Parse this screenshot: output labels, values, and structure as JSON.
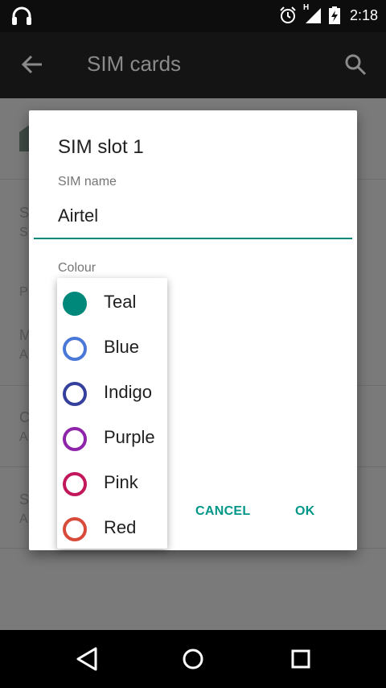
{
  "status": {
    "time": "2:18",
    "network_label": "H"
  },
  "appbar": {
    "title": "SIM cards"
  },
  "background_list": {
    "rows": [
      {
        "text": "S"
      },
      {
        "text": "S"
      },
      {
        "text": "P"
      },
      {
        "text": "M"
      },
      {
        "text": "A"
      },
      {
        "text": "C"
      },
      {
        "text": "A"
      },
      {
        "text": "S"
      },
      {
        "text": "A"
      }
    ]
  },
  "dialog": {
    "title": "SIM slot 1",
    "sim_name_label": "SIM name",
    "sim_name_value": "Airtel",
    "colour_label": "Colour",
    "cancel_label": "CANCEL",
    "ok_label": "OK",
    "accent_color": "#00897b"
  },
  "colour_options": [
    {
      "label": "Teal",
      "color": "#00897b",
      "selected": true
    },
    {
      "label": "Blue",
      "color": "#4a78d8",
      "selected": false
    },
    {
      "label": "Indigo",
      "color": "#35409c",
      "selected": false
    },
    {
      "label": "Purple",
      "color": "#8e24aa",
      "selected": false
    },
    {
      "label": "Pink",
      "color": "#c2185b",
      "selected": false
    },
    {
      "label": "Red",
      "color": "#d84b3b",
      "selected": false
    }
  ]
}
